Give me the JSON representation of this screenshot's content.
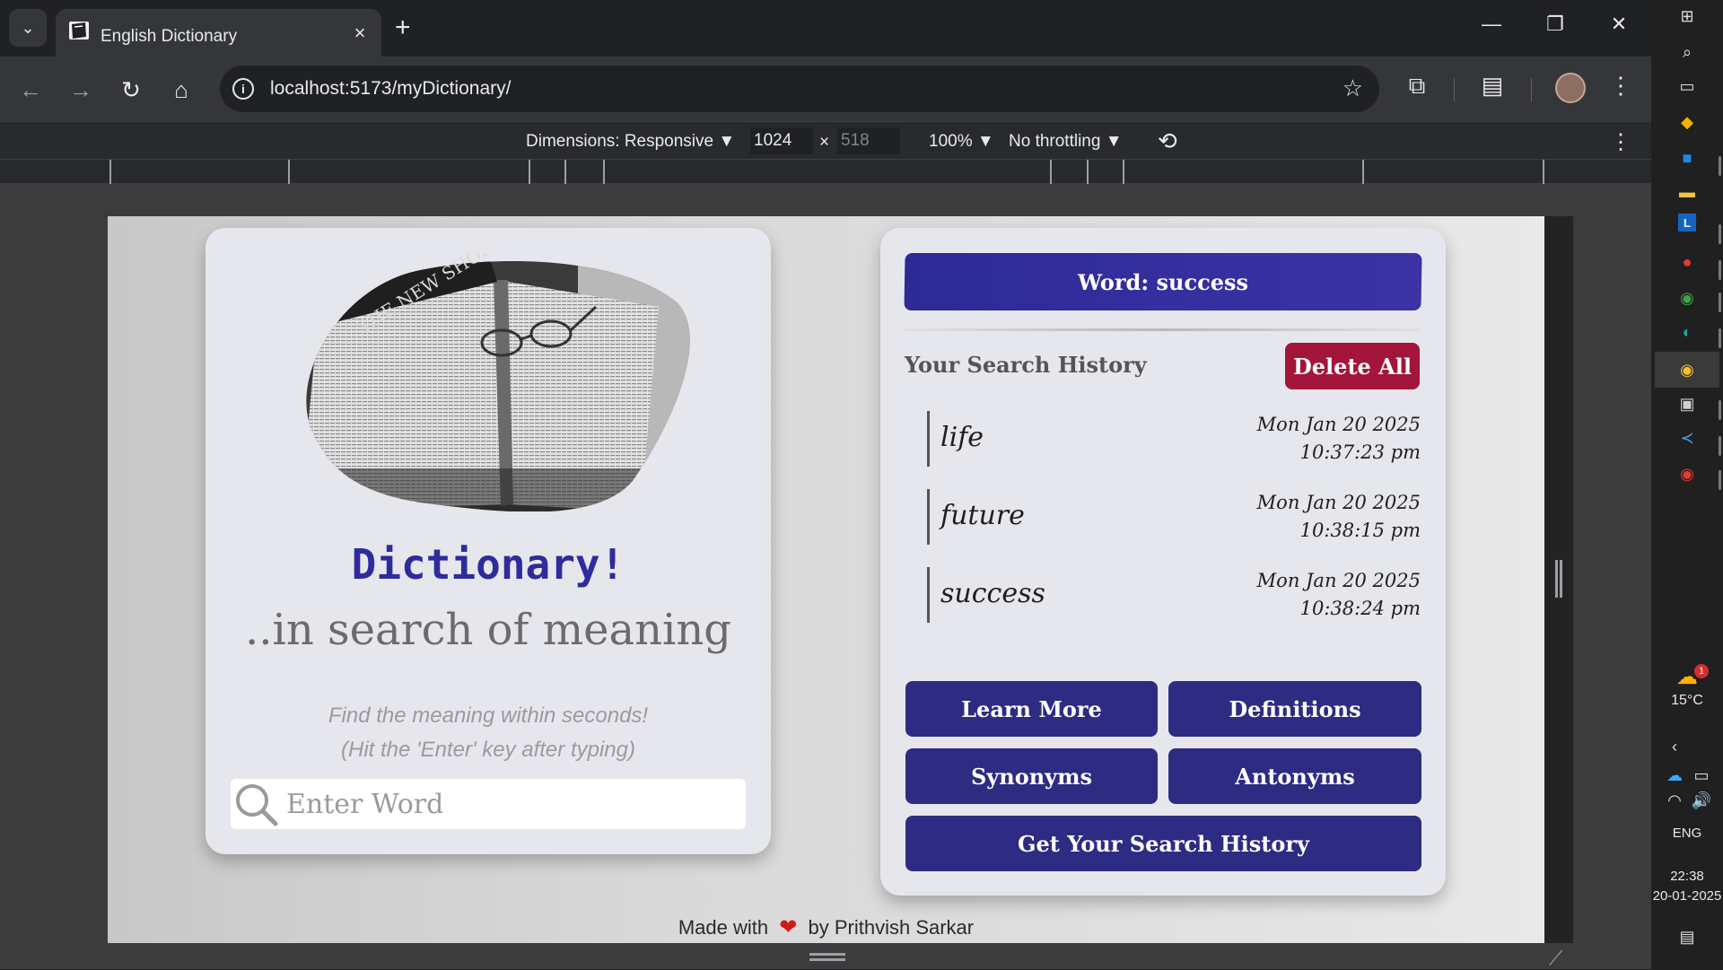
{
  "browser": {
    "tab_title": "English Dictionary",
    "tab_close_glyph": "×",
    "new_tab_glyph": "+",
    "url_host": "localhost",
    "url_path": ":5173/myDictionary/",
    "window_controls": {
      "minimize": "—",
      "restore": "❐",
      "close": "✕"
    }
  },
  "devtools": {
    "dimensions_label": "Dimensions: Responsive ▼",
    "width_value": "1024",
    "height_value": "518",
    "times": "×",
    "zoom": "100% ▼",
    "throttling": "No throttling ▼"
  },
  "page": {
    "title": "Dictionary!",
    "subtitle": "..in search of meaning",
    "hint_line1": "Find the meaning within seconds!",
    "hint_line2": "(Hit the 'Enter' key after typing)",
    "search_placeholder": "Enter Word",
    "word_banner": "Word: success",
    "history_heading": "Your Search History",
    "delete_all_label": "Delete All",
    "history": [
      {
        "word": "life",
        "date": "Mon Jan 20 2025",
        "time": "10:37:23 pm"
      },
      {
        "word": "future",
        "date": "Mon Jan 20 2025",
        "time": "10:38:15 pm"
      },
      {
        "word": "success",
        "date": "Mon Jan 20 2025",
        "time": "10:38:24 pm"
      }
    ],
    "buttons": {
      "learn_more": "Learn More",
      "definitions": "Definitions",
      "synonyms": "Synonyms",
      "antonyms": "Antonyms",
      "get_history": "Get Your Search History"
    },
    "footer_before": "Made with",
    "footer_after": "by Prithvish Sarkar",
    "hero_book_text": "THE NEW SHORTER OXFORD"
  },
  "taskbar": {
    "weather_temp": "15°C",
    "weather_badge": "1",
    "language": "ENG",
    "clock_time": "22:38",
    "clock_date": "20-01-2025"
  },
  "colors": {
    "accent": "#2e2b83",
    "title_blue": "#2e2c9c",
    "danger": "#a3153a",
    "heart": "#d01b1b"
  }
}
